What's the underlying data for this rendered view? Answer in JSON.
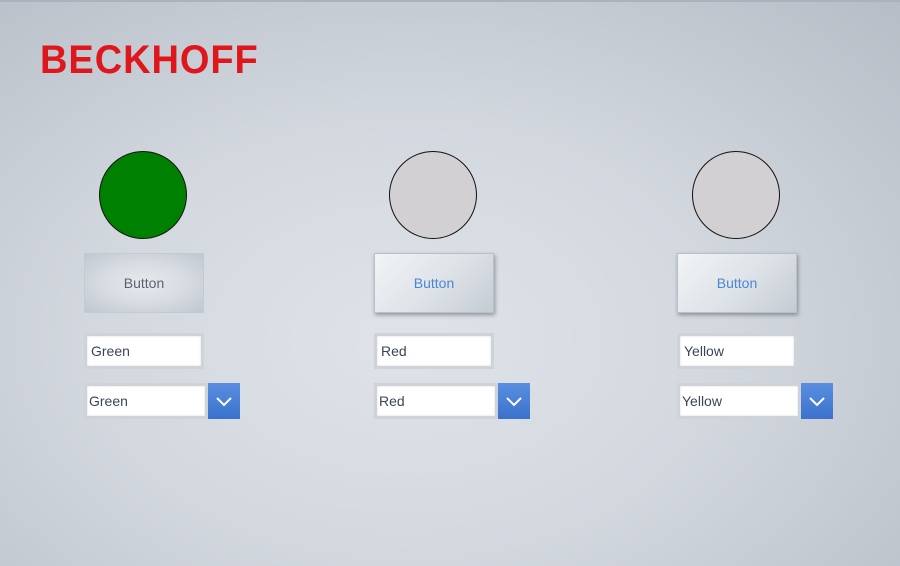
{
  "brand": {
    "logo_text": "BECKHOFF",
    "logo_color": "#e0161d"
  },
  "colors": {
    "lamp_green": "#008000",
    "lamp_off": "#d2d0d2",
    "button_text_active": "#4a87d6",
    "dropdown_arrow_bg": "#3a72cc"
  },
  "panels": [
    {
      "lamp_state": "on",
      "lamp_color": "#008000",
      "button_label": "Button",
      "button_state": "pressed",
      "text_field_value": "Green",
      "dropdown_value": "Green",
      "dropdown_icon": "chevron-down-icon"
    },
    {
      "lamp_state": "off",
      "lamp_color": "#d2d0d2",
      "button_label": "Button",
      "button_state": "normal",
      "text_field_value": "Red",
      "dropdown_value": "Red",
      "dropdown_icon": "chevron-down-icon"
    },
    {
      "lamp_state": "off",
      "lamp_color": "#d2d0d2",
      "button_label": "Button",
      "button_state": "normal",
      "text_field_value": "Yellow",
      "dropdown_value": "Yellow",
      "dropdown_icon": "chevron-down-icon"
    }
  ]
}
